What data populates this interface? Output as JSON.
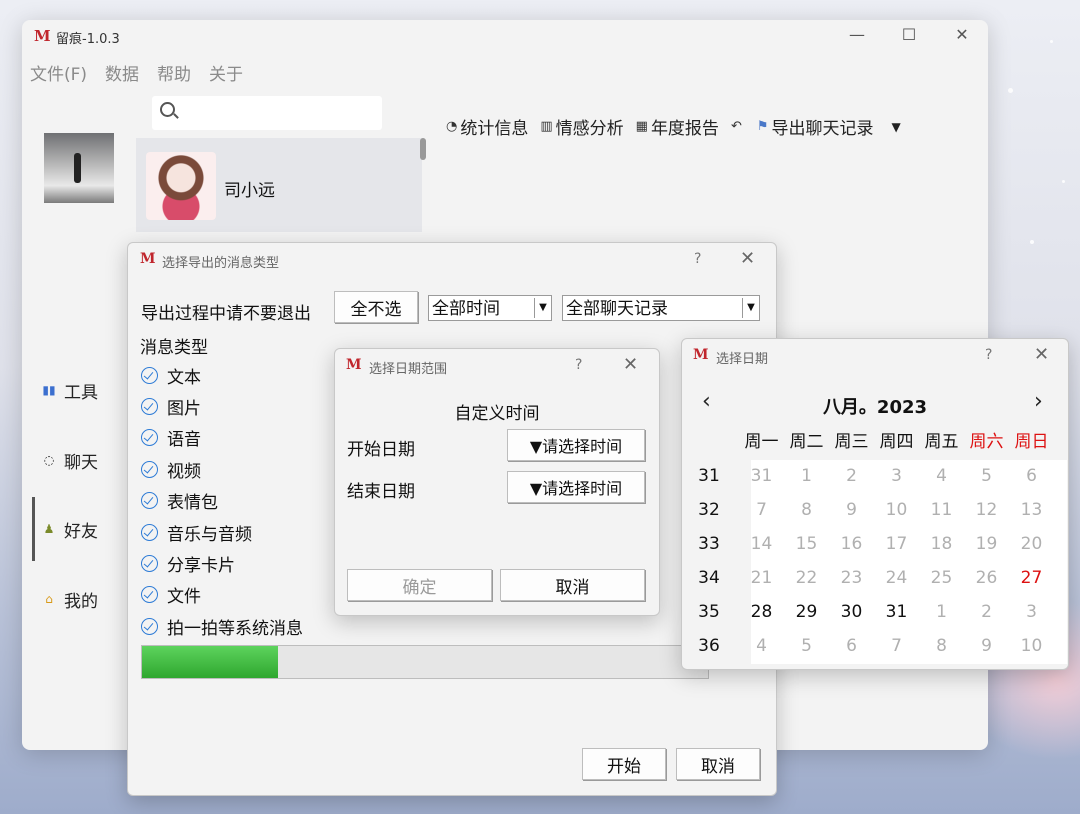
{
  "main_window": {
    "title": "留痕-1.0.3",
    "menu": [
      "文件(F)",
      "数据",
      "帮助",
      "关于"
    ],
    "search_placeholder": "",
    "contact_name": "司小远",
    "toolbar": {
      "stats": "统计信息",
      "sentiment": "情感分析",
      "annual": "年度报告",
      "export": "导出聊天记录"
    },
    "nav": [
      "工具",
      "聊天",
      "好友",
      "我的"
    ],
    "active_nav": "好友"
  },
  "export_dialog": {
    "title": "选择导出的消息类型",
    "help": "?",
    "warning": "导出过程中请不要退出",
    "select_none": "全不选",
    "time_combo": "全部时间",
    "record_combo": "全部聊天记录",
    "message_types_title": "消息类型",
    "message_types": [
      "文本",
      "图片",
      "语音",
      "视频",
      "表情包",
      "音乐与音频",
      "分享卡片",
      "文件",
      "拍一拍等系统消息"
    ],
    "progress": 0.24,
    "start": "开始",
    "cancel": "取消"
  },
  "range_dialog": {
    "title": "选择日期范围",
    "help": "?",
    "heading": "自定义时间",
    "start_label": "开始日期",
    "end_label": "结束日期",
    "start_value": "▼请选择时间",
    "end_value": "▼请选择时间",
    "ok": "确定",
    "cancel": "取消"
  },
  "calendar_dialog": {
    "title": "选择日期",
    "help": "?",
    "month_label": "八月。2023",
    "prev": "‹",
    "next": "›",
    "weekdays": [
      "周一",
      "周二",
      "周三",
      "周四",
      "周五",
      "周六",
      "周日"
    ],
    "weeks": [
      {
        "week": "31",
        "days": [
          "31",
          "1",
          "2",
          "3",
          "4",
          "5",
          "6"
        ]
      },
      {
        "week": "32",
        "days": [
          "7",
          "8",
          "9",
          "10",
          "11",
          "12",
          "13"
        ]
      },
      {
        "week": "33",
        "days": [
          "14",
          "15",
          "16",
          "17",
          "18",
          "19",
          "20"
        ]
      },
      {
        "week": "34",
        "days": [
          "21",
          "22",
          "23",
          "24",
          "25",
          "26",
          "27"
        ]
      },
      {
        "week": "35",
        "days": [
          "28",
          "29",
          "30",
          "31",
          "1",
          "2",
          "3"
        ]
      },
      {
        "week": "36",
        "days": [
          "4",
          "5",
          "6",
          "7",
          "8",
          "9",
          "10"
        ]
      }
    ],
    "highlighted_day": "27",
    "accent_color": "#dd1111"
  }
}
